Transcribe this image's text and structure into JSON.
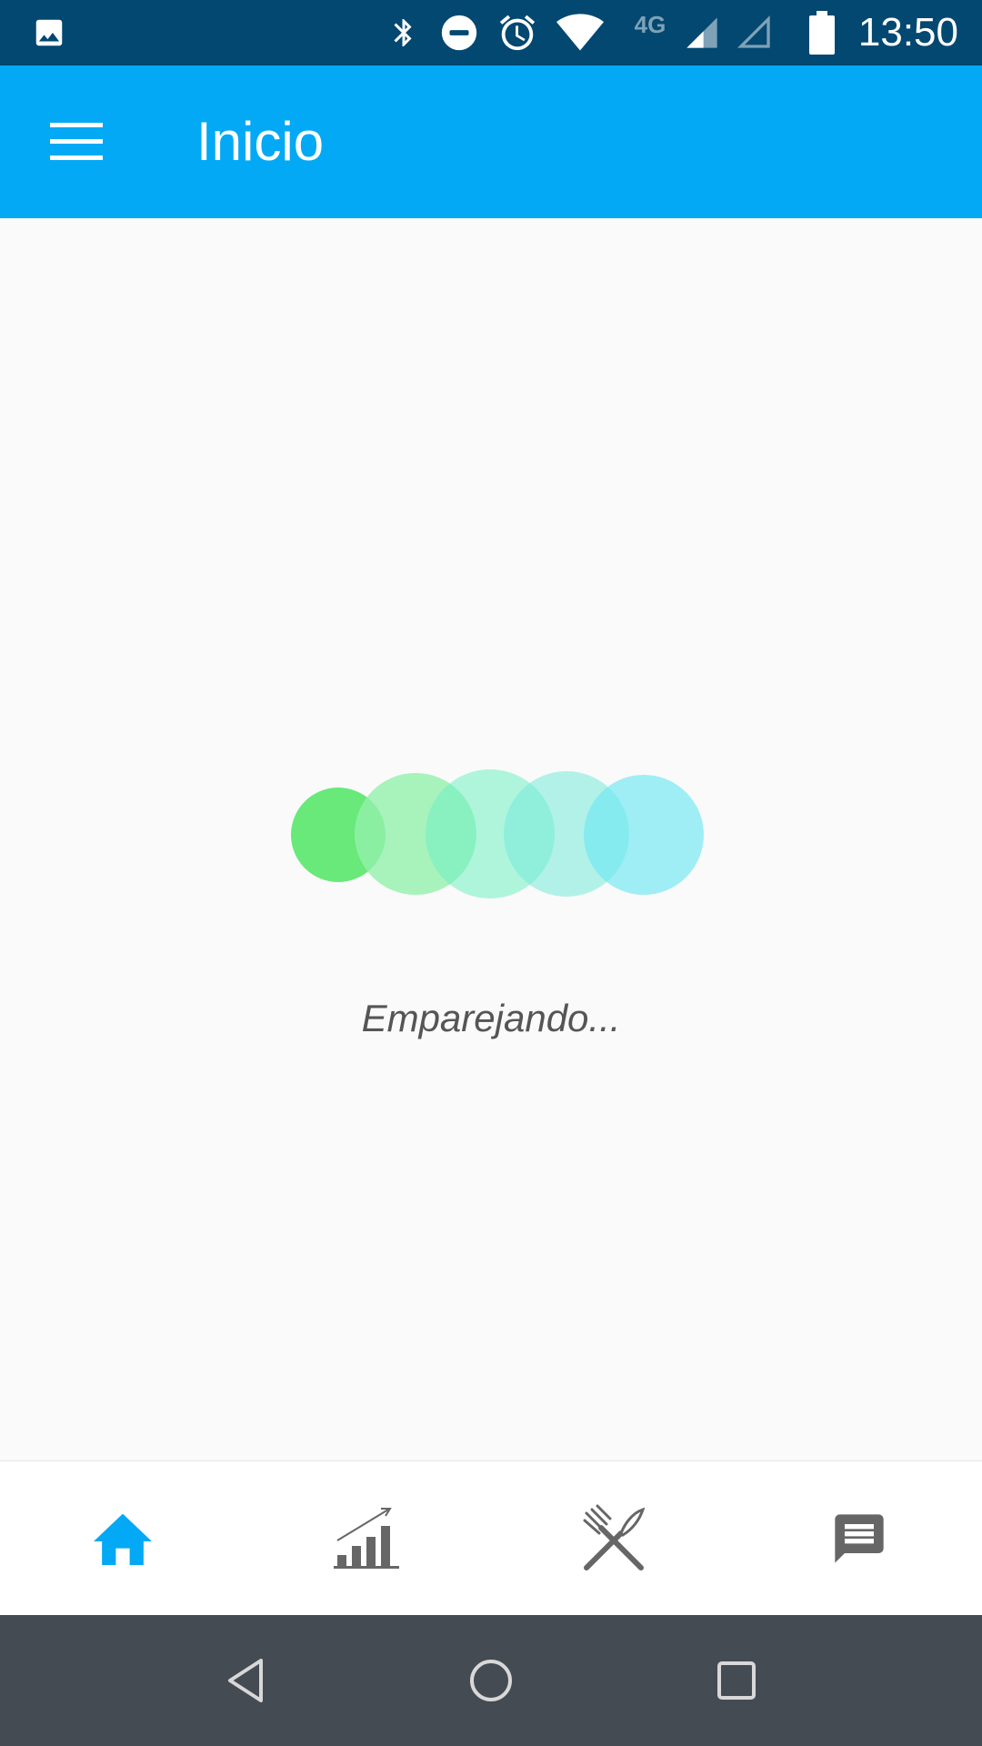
{
  "status_bar": {
    "time": "13:50",
    "network_label": "4G",
    "icons": [
      "image-icon",
      "bluetooth-icon",
      "do-not-disturb-icon",
      "alarm-icon",
      "wifi-icon",
      "signal-icon",
      "signal-empty-icon",
      "battery-icon"
    ]
  },
  "app_bar": {
    "title": "Inicio",
    "menu_icon": "hamburger-menu-icon"
  },
  "main": {
    "status_text": "Emparejando...",
    "loader_colors": [
      "#4ee563",
      "#94f0ac",
      "#6ff0c2",
      "#76ead9",
      "#6ee8f3"
    ]
  },
  "bottom_nav": {
    "items": [
      {
        "icon": "home-icon",
        "active": true
      },
      {
        "icon": "stats-chart-icon",
        "active": false
      },
      {
        "icon": "fork-knife-icon",
        "active": false
      },
      {
        "icon": "chat-icon",
        "active": false
      }
    ],
    "active_color": "#03a9f4",
    "inactive_color": "#666666"
  },
  "system_nav": {
    "buttons": [
      "back-icon",
      "home-circle-icon",
      "recents-icon"
    ]
  },
  "colors": {
    "status_bar": "#024871",
    "app_bar": "#03a9f4",
    "background": "#fafafa",
    "system_nav": "#454b52"
  }
}
